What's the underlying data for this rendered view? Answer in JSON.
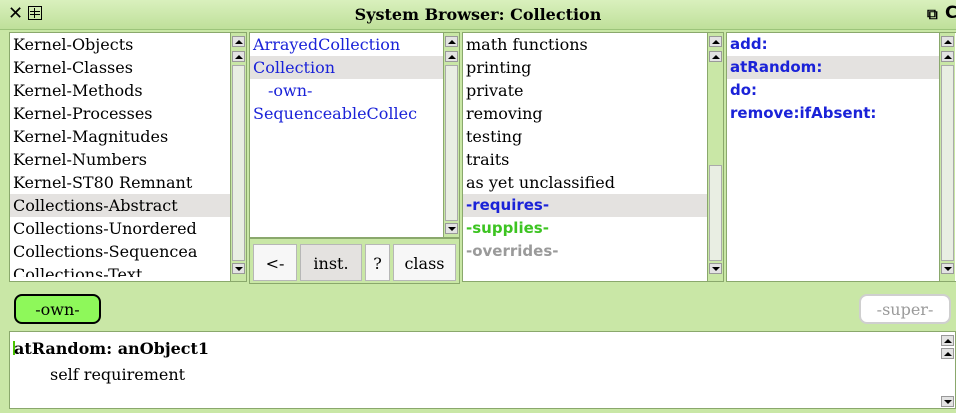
{
  "window": {
    "title": "System Browser: Collection",
    "icons": [
      "close-icon",
      "window-menu-icon",
      "collapse-icon",
      "more-icon"
    ]
  },
  "categories": {
    "items": [
      "Kernel-Objects",
      "Kernel-Classes",
      "Kernel-Methods",
      "Kernel-Processes",
      "Kernel-Magnitudes",
      "Kernel-Numbers",
      "Kernel-ST80 Remnant",
      "Collections-Abstract",
      "Collections-Unordered",
      "Collections-Sequencea",
      "Collections-Text"
    ],
    "selected": "Collections-Abstract"
  },
  "classes": {
    "items": [
      "ArrayedCollection",
      "Collection",
      "-own-",
      "SequenceableCollec"
    ],
    "selected": "Collection"
  },
  "toggles": {
    "back": "<-",
    "instance": "inst.",
    "help": "?",
    "class": "class",
    "active": "inst."
  },
  "protocols": {
    "items": [
      "math functions",
      "printing",
      "private",
      "removing",
      "testing",
      "traits",
      "as yet unclassified"
    ],
    "special": [
      "-requires-",
      "-supplies-",
      "-overrides-"
    ],
    "selected": "-requires-",
    "colors": {
      "requires": "#1a22d8",
      "supplies": "#3dc422",
      "overrides": "#9a9a9a"
    }
  },
  "selectors": {
    "items": [
      "add:",
      "atRandom:",
      "do:",
      "remove:ifAbsent:"
    ],
    "selected": "atRandom:"
  },
  "buttons": {
    "own": "-own-",
    "super": "-super-"
  },
  "code": {
    "line1": "atRandom: anObject1",
    "line2": "self requirement"
  },
  "colors": {
    "window_bg": "#c9e7a6",
    "selection_blue": "#1a22d8",
    "own_button": "#8ef85a"
  }
}
